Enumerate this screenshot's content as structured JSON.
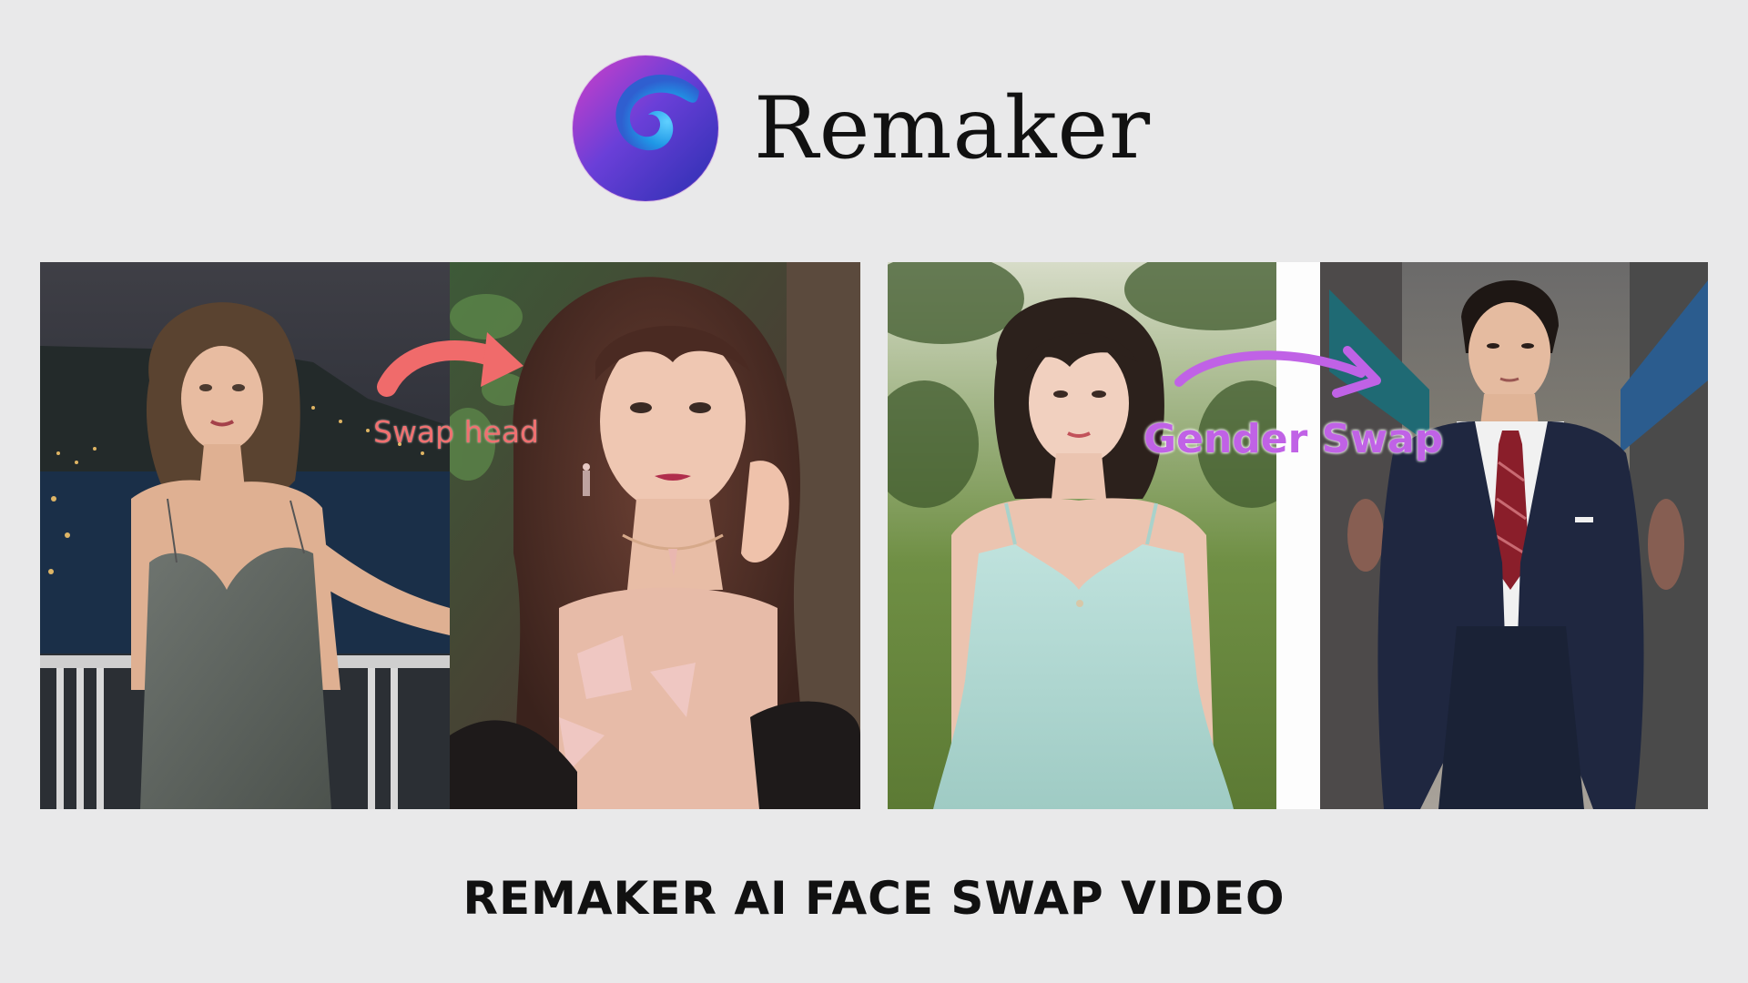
{
  "brand": {
    "name": "Remaker",
    "logo_icon": "swirl-logo-icon",
    "colors": {
      "logo_magenta": "#c43ad0",
      "logo_blue": "#1f97e6",
      "logo_deep": "#4a2fc7"
    }
  },
  "panels": [
    {
      "id": "original-woman-balcony",
      "alt": "woman in grey dress on balcony at night"
    },
    {
      "id": "swapped-woman-curly-hair",
      "alt": "woman with long wavy brown hair"
    },
    {
      "id": "original-woman-park",
      "alt": "short-haired woman in mint dress in park"
    },
    {
      "id": "swapped-man-suit",
      "alt": "man in navy suit with red tie on street"
    }
  ],
  "annotations": {
    "swap_head": {
      "label": "Swap head",
      "color": "#f06b6b",
      "icon": "curved-arrow-icon"
    },
    "gender_swap": {
      "label": "Gender Swap",
      "color": "#c062e6",
      "icon": "curved-arrow-icon"
    }
  },
  "caption": "REMAKER AI FACE SWAP VIDEO"
}
